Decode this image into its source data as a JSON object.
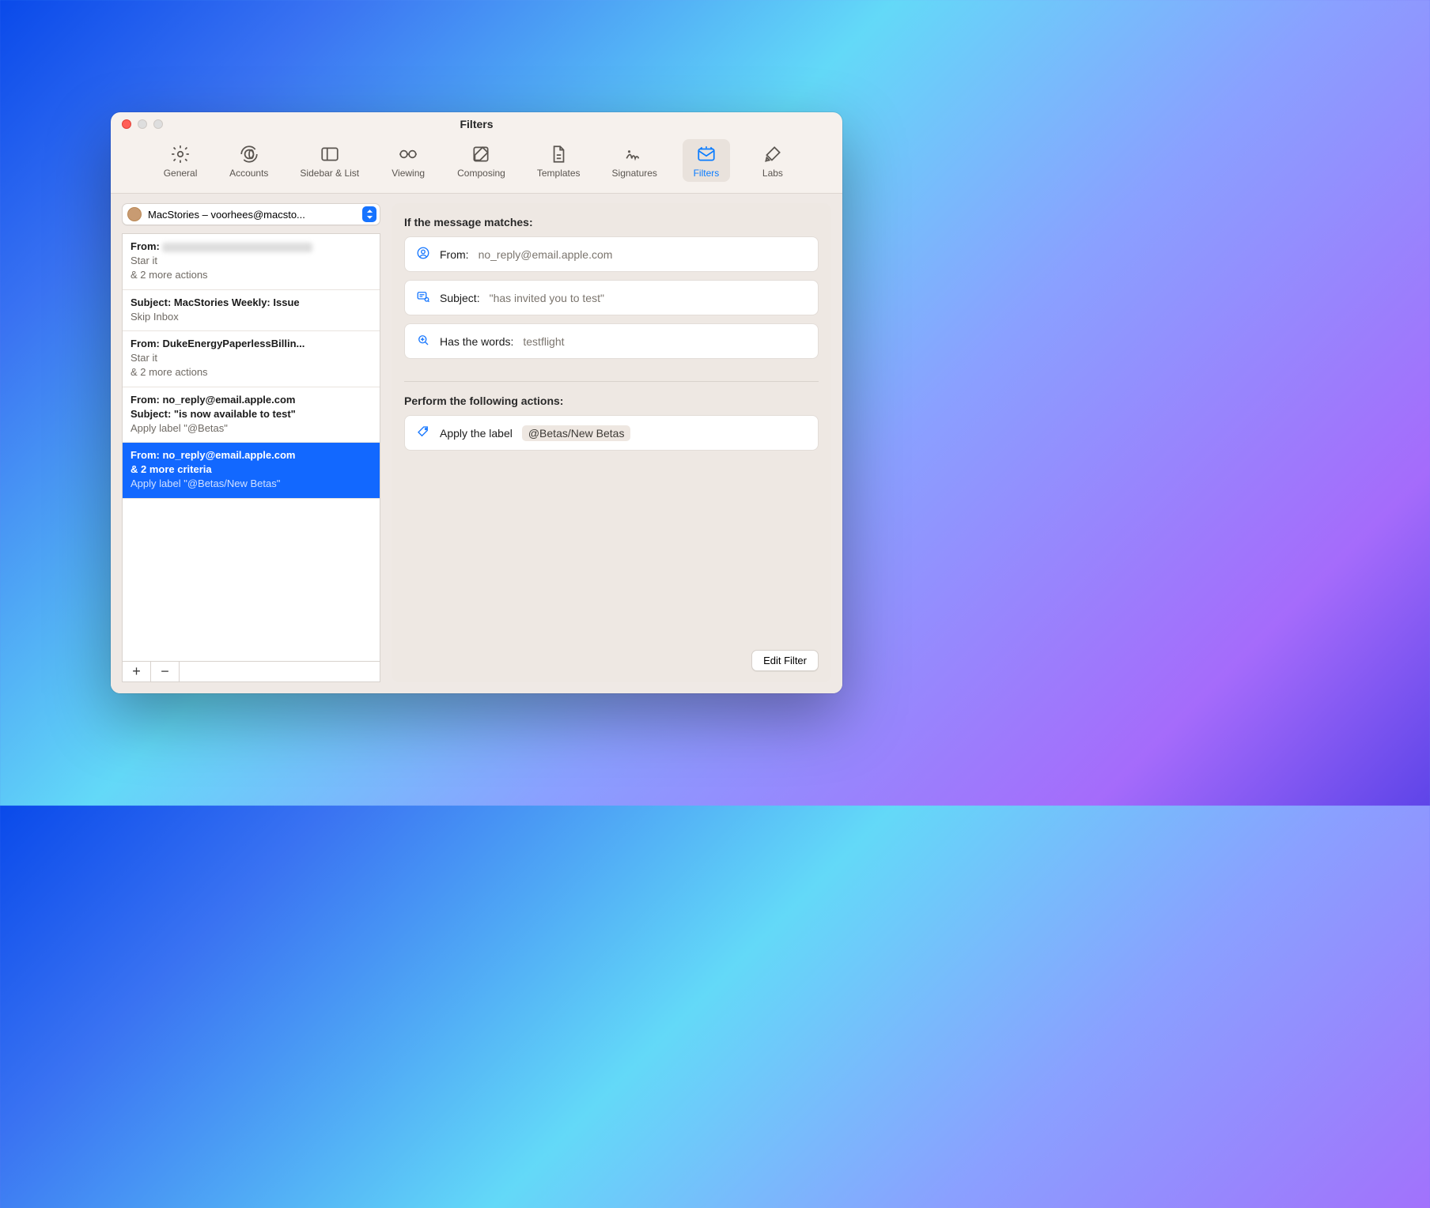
{
  "window": {
    "title": "Filters"
  },
  "toolbar": {
    "items": [
      {
        "label": "General"
      },
      {
        "label": "Accounts"
      },
      {
        "label": "Sidebar & List"
      },
      {
        "label": "Viewing"
      },
      {
        "label": "Composing"
      },
      {
        "label": "Templates"
      },
      {
        "label": "Signatures"
      },
      {
        "label": "Filters"
      },
      {
        "label": "Labs"
      }
    ],
    "active_index": 7
  },
  "account_picker": {
    "label": "MacStories – voorhees@macsto..."
  },
  "filter_list": {
    "items": [
      {
        "l1": "From:",
        "blurred": true,
        "meta1": "Star it",
        "meta2": "& 2 more actions"
      },
      {
        "l1": "Subject: MacStories Weekly: Issue",
        "meta1": "Skip Inbox"
      },
      {
        "l1": "From: DukeEnergyPaperlessBillin...",
        "meta1": "Star it",
        "meta2": "& 2 more actions"
      },
      {
        "l1": "From: no_reply@email.apple.com",
        "l2": "Subject: \"is now available to test\"",
        "meta1": "Apply label \"@Betas\""
      },
      {
        "l1": "From: no_reply@email.apple.com",
        "l2": "& 2 more criteria",
        "meta1": "Apply label \"@Betas/New Betas\"",
        "selected": true
      }
    ]
  },
  "detail": {
    "matches_title": "If the message matches:",
    "conditions": [
      {
        "icon": "person",
        "label": "From:",
        "value": "no_reply@email.apple.com"
      },
      {
        "icon": "subject",
        "label": "Subject:",
        "value": "\"has invited you to test\""
      },
      {
        "icon": "search",
        "label": "Has the words:",
        "value": "testflight"
      }
    ],
    "actions_title": "Perform the following actions:",
    "actions": [
      {
        "icon": "tag",
        "label": "Apply the label",
        "chip": "@Betas/New Betas"
      }
    ],
    "edit_button": "Edit Filter"
  },
  "buttons": {
    "add": "+",
    "remove": "−"
  }
}
